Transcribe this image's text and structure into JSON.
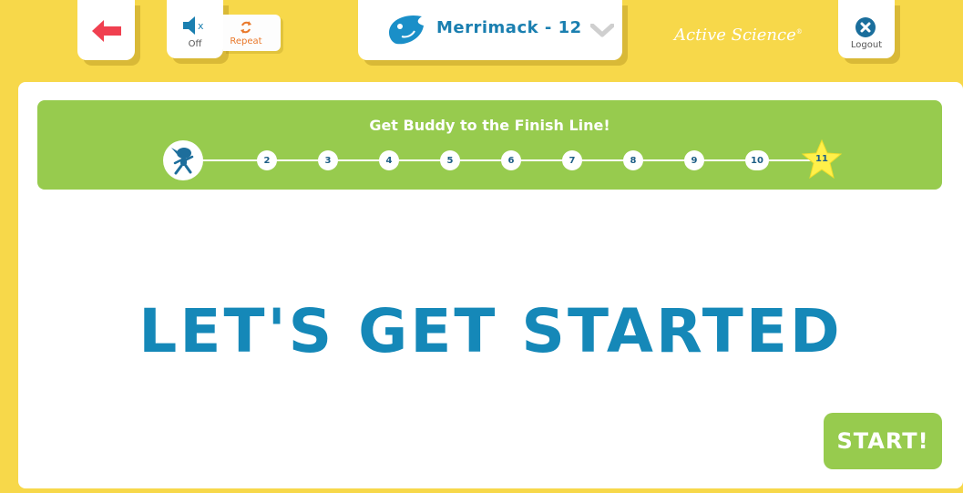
{
  "toolbar": {
    "sound_label": "Off",
    "repeat_label": "Repeat",
    "user_name": "Merrimack - 12",
    "brand": "Active Science",
    "logout_label": "Logout"
  },
  "progress": {
    "title": "Get Buddy to the Finish Line!",
    "steps": [
      "2",
      "3",
      "4",
      "5",
      "6",
      "7",
      "8",
      "9",
      "10"
    ],
    "finish_step": "11",
    "current_step": 1
  },
  "main": {
    "headline": "LET'S GET STARTED",
    "start_label": "START!"
  },
  "colors": {
    "background": "#f7d84a",
    "accent_green": "#97cb4e",
    "headline_blue": "#1588b8",
    "back_red": "#f04050"
  }
}
